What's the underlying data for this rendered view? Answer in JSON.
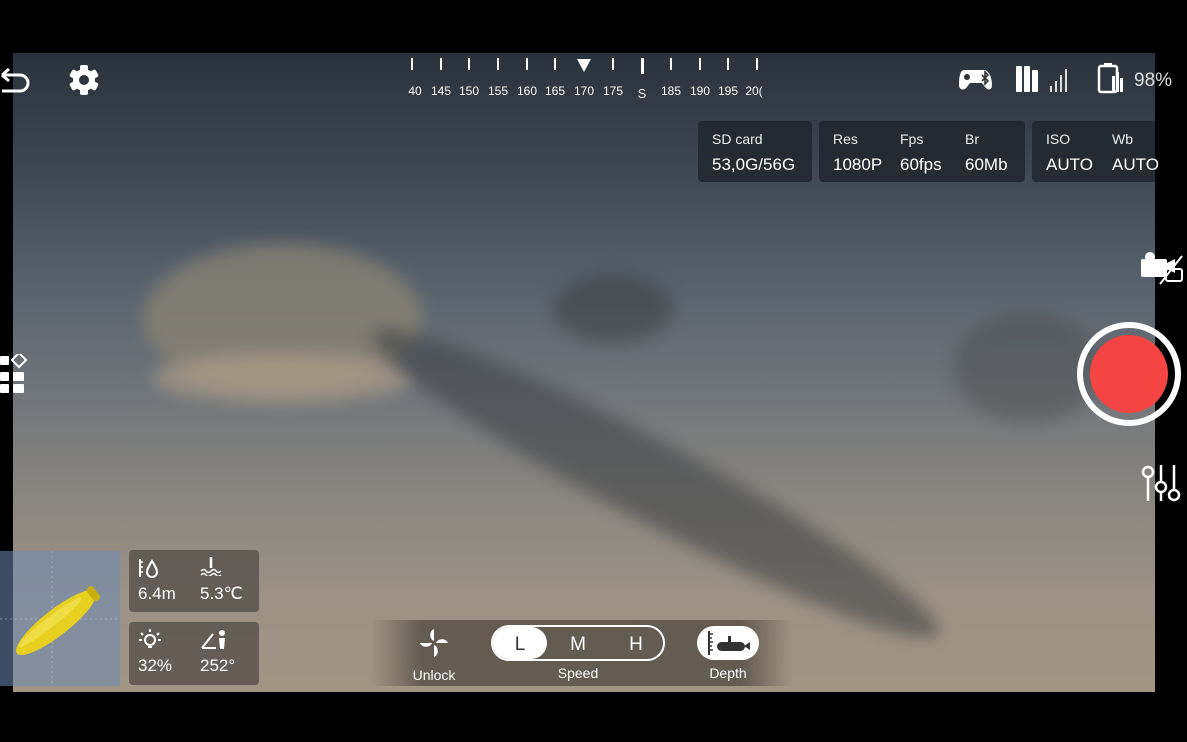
{
  "compass": {
    "labels": [
      "40",
      "145",
      "150",
      "155",
      "160",
      "165",
      "170",
      "175",
      "S",
      "185",
      "190",
      "195",
      "20("
    ],
    "current": "170"
  },
  "status": {
    "controller_icon": "gamepad-bluetooth-icon",
    "signal_icon": "signal-icon",
    "battery_icon": "battery-icon",
    "battery": "98%"
  },
  "camera_info": {
    "sd": {
      "label": "SD card",
      "value": "53,0G/56G"
    },
    "res": {
      "label": "Res",
      "value": "1080P"
    },
    "fps": {
      "label": "Fps",
      "value": "60fps"
    },
    "br": {
      "label": "Br",
      "value": "60Mb"
    },
    "iso": {
      "label": "ISO",
      "value": "AUTO"
    },
    "wb": {
      "label": "Wb",
      "value": "AUTO"
    }
  },
  "telemetry": {
    "depth": "6.4m",
    "temperature": "5.3℃",
    "light": "32%",
    "heading": "252°"
  },
  "controls": {
    "unlock": "Unlock",
    "speed_label": "Speed",
    "speed_options": [
      "L",
      "M",
      "H"
    ],
    "speed_selected": "L",
    "depth": "Depth"
  },
  "colors": {
    "record": "#f44444",
    "drone": "#e8d020"
  }
}
